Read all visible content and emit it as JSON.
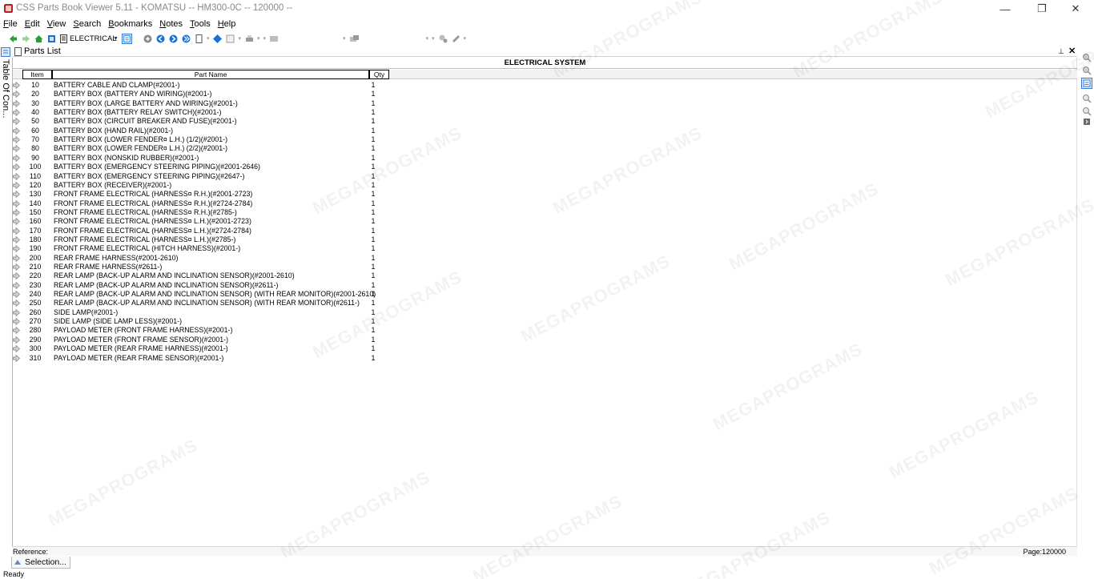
{
  "window": {
    "title": "CSS Parts Book Viewer 5.11 - KOMATSU -- HM300-0C -- 120000 --",
    "minimize_glyph": "—",
    "maximize_glyph": "❐",
    "close_glyph": "✕"
  },
  "menu": [
    {
      "label": "File",
      "accel": "F",
      "rest": "ile"
    },
    {
      "label": "Edit",
      "accel": "E",
      "rest": "dit"
    },
    {
      "label": "View",
      "accel": "V",
      "rest": "iew"
    },
    {
      "label": "Search",
      "accel": "S",
      "rest": "earch"
    },
    {
      "label": "Bookmarks",
      "accel": "B",
      "rest": "ookmarks"
    },
    {
      "label": "Notes",
      "accel": "N",
      "rest": "otes"
    },
    {
      "label": "Tools",
      "accel": "T",
      "rest": "ools"
    },
    {
      "label": "Help",
      "accel": "H",
      "rest": "elp"
    }
  ],
  "toolbar": {
    "section_combo": "ELECTRICAL"
  },
  "toc_tab": {
    "label": "Table Of Con..."
  },
  "panel": {
    "title": "Parts List",
    "pin_glyph": "📌",
    "close_glyph": "✕"
  },
  "section_title": "ELECTRICAL SYSTEM",
  "columns": {
    "item": "Item",
    "part_name": "Part Name",
    "qty": "Qty"
  },
  "parts": [
    {
      "item": "10",
      "name": "BATTERY CABLE AND CLAMP(#2001-)",
      "qty": "1"
    },
    {
      "item": "20",
      "name": "BATTERY BOX (BATTERY AND WIRING)(#2001-)",
      "qty": "1"
    },
    {
      "item": "30",
      "name": "BATTERY BOX (LARGE BATTERY AND WIRING)(#2001-)",
      "qty": "1"
    },
    {
      "item": "40",
      "name": "BATTERY BOX (BATTERY RELAY SWITCH)(#2001-)",
      "qty": "1"
    },
    {
      "item": "50",
      "name": "BATTERY BOX (CIRCUIT BREAKER AND FUSE)(#2001-)",
      "qty": "1"
    },
    {
      "item": "60",
      "name": "BATTERY BOX (HAND RAIL)(#2001-)",
      "qty": "1"
    },
    {
      "item": "70",
      "name": "BATTERY BOX (LOWER FENDER¤ L.H.) (1/2)(#2001-)",
      "qty": "1"
    },
    {
      "item": "80",
      "name": "BATTERY BOX (LOWER FENDER¤ L.H.) (2/2)(#2001-)",
      "qty": "1"
    },
    {
      "item": "90",
      "name": "BATTERY BOX (NONSKID RUBBER)(#2001-)",
      "qty": "1"
    },
    {
      "item": "100",
      "name": "BATTERY BOX (EMERGENCY STEERING PIPING)(#2001-2646)",
      "qty": "1"
    },
    {
      "item": "110",
      "name": "BATTERY BOX (EMERGENCY STEERING PIPING)(#2647-)",
      "qty": "1"
    },
    {
      "item": "120",
      "name": "BATTERY BOX (RECEIVER)(#2001-)",
      "qty": "1"
    },
    {
      "item": "130",
      "name": "FRONT FRAME ELECTRICAL (HARNESS¤ R.H.)(#2001-2723)",
      "qty": "1"
    },
    {
      "item": "140",
      "name": "FRONT FRAME ELECTRICAL (HARNESS¤ R.H.)(#2724-2784)",
      "qty": "1"
    },
    {
      "item": "150",
      "name": "FRONT FRAME ELECTRICAL (HARNESS¤ R.H.)(#2785-)",
      "qty": "1"
    },
    {
      "item": "160",
      "name": "FRONT FRAME ELECTRICAL (HARNESS¤ L.H.)(#2001-2723)",
      "qty": "1"
    },
    {
      "item": "170",
      "name": "FRONT FRAME ELECTRICAL (HARNESS¤ L.H.)(#2724-2784)",
      "qty": "1"
    },
    {
      "item": "180",
      "name": "FRONT FRAME ELECTRICAL (HARNESS¤ L.H.)(#2785-)",
      "qty": "1"
    },
    {
      "item": "190",
      "name": "FRONT FRAME ELECTRICAL (HITCH HARNESS)(#2001-)",
      "qty": "1"
    },
    {
      "item": "200",
      "name": "REAR FRAME HARNESS(#2001-2610)",
      "qty": "1"
    },
    {
      "item": "210",
      "name": "REAR FRAME HARNESS(#2611-)",
      "qty": "1"
    },
    {
      "item": "220",
      "name": "REAR LAMP (BACK-UP ALARM AND INCLINATION SENSOR)(#2001-2610)",
      "qty": "1"
    },
    {
      "item": "230",
      "name": "REAR LAMP (BACK-UP ALARM AND INCLINATION SENSOR)(#2611-)",
      "qty": "1"
    },
    {
      "item": "240",
      "name": "REAR LAMP (BACK-UP ALARM AND INCLINATION SENSOR) (WITH REAR MONITOR)(#2001-2610)",
      "qty": "1"
    },
    {
      "item": "250",
      "name": "REAR LAMP (BACK-UP ALARM AND INCLINATION SENSOR) (WITH REAR MONITOR)(#2611-)",
      "qty": "1"
    },
    {
      "item": "260",
      "name": "SIDE LAMP(#2001-)",
      "qty": "1"
    },
    {
      "item": "270",
      "name": "SIDE LAMP (SIDE LAMP LESS)(#2001-)",
      "qty": "1"
    },
    {
      "item": "280",
      "name": "PAYLOAD METER (FRONT FRAME HARNESS)(#2001-)",
      "qty": "1"
    },
    {
      "item": "290",
      "name": "PAYLOAD METER (FRONT FRAME SENSOR)(#2001-)",
      "qty": "1"
    },
    {
      "item": "300",
      "name": "PAYLOAD METER (REAR FRAME HARNESS)(#2001-)",
      "qty": "1"
    },
    {
      "item": "310",
      "name": "PAYLOAD METER (REAR FRAME SENSOR)(#2001-)",
      "qty": "1"
    }
  ],
  "reference_bar": {
    "reference_label": "Reference:",
    "page_label": "Page:120000"
  },
  "bottom_tab": {
    "label": "Selection..."
  },
  "status": {
    "text": "Ready"
  },
  "watermark": {
    "text": "MEGAPROGRAMS"
  },
  "colors": {
    "accent": "#3a7bd5",
    "toolbar_green": "#2e9b3a",
    "toolbar_blue": "#1e6fd0"
  }
}
